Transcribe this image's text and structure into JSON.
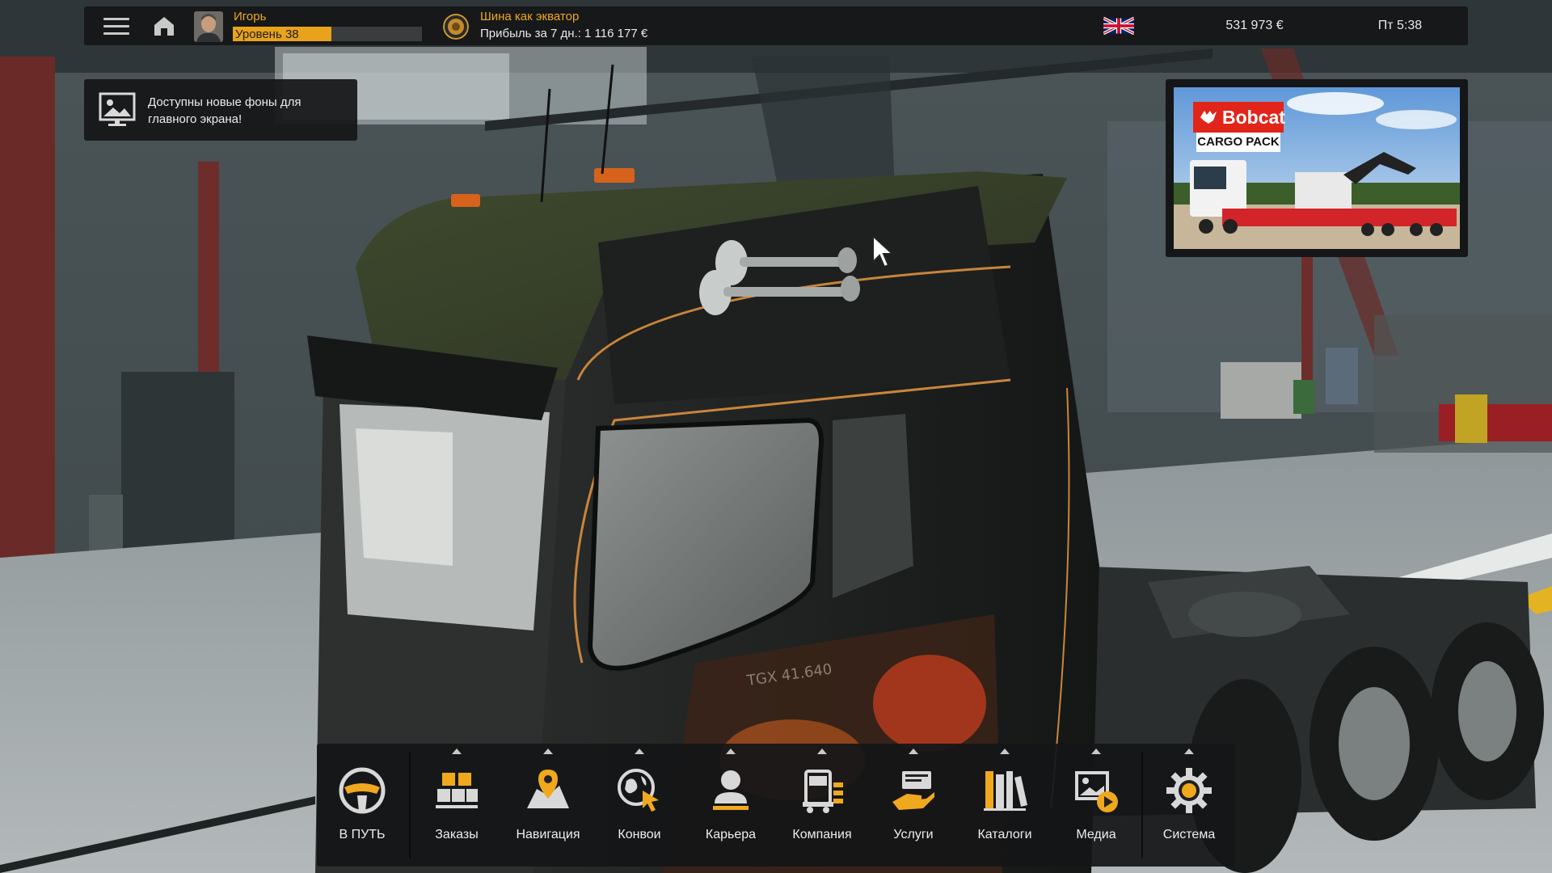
{
  "topbar": {
    "menu_icon": "hamburger-icon",
    "home_icon": "home-icon",
    "player": {
      "name": "Игорь",
      "level": "Уровень 38",
      "level_progress": 0.52
    },
    "company": {
      "name": "Шина как экватор",
      "profit": "Прибыль за 7 дн.: 1 116 177 €"
    },
    "language_icon": "uk-flag-icon",
    "money": "531 973 €",
    "time": "Пт 5:38"
  },
  "notification": {
    "icon": "wallpaper-icon",
    "text": "Доступны новые фоны для главного экрана!"
  },
  "ad": {
    "brand": "Bobcat",
    "subtitle": "CARGO PACK"
  },
  "dock": {
    "items": [
      {
        "label": "В ПУТЬ",
        "icon": "steering-wheel-icon",
        "caret": false
      },
      {
        "label": "Заказы",
        "icon": "cargo-boxes-icon",
        "caret": true
      },
      {
        "label": "Навигация",
        "icon": "map-pin-icon",
        "caret": true
      },
      {
        "label": "Конвои",
        "icon": "globe-cursor-icon",
        "caret": true
      },
      {
        "label": "Карьера",
        "icon": "person-icon",
        "caret": true
      },
      {
        "label": "Компания",
        "icon": "truck-company-icon",
        "caret": true
      },
      {
        "label": "Услуги",
        "icon": "service-icon",
        "caret": true
      },
      {
        "label": "Каталоги",
        "icon": "catalog-books-icon",
        "caret": true
      },
      {
        "label": "Медиа",
        "icon": "media-icon",
        "caret": true
      },
      {
        "label": "Система",
        "icon": "gear-icon",
        "caret": true
      }
    ]
  },
  "colors": {
    "accent": "#f0a81f",
    "panel": "#141618",
    "text": "#eeeeee"
  }
}
